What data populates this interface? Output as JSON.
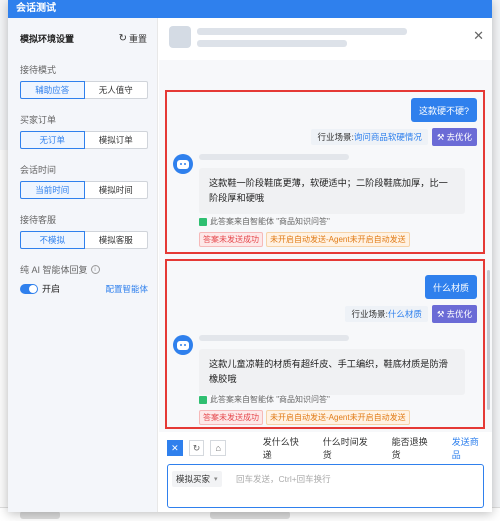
{
  "window": {
    "title": "会话测试"
  },
  "settings": {
    "title": "模拟环境设置",
    "reset_label": "重置",
    "reception_mode": {
      "label": "接待模式",
      "options": [
        "辅助应答",
        "无人值守"
      ],
      "active": 0
    },
    "buyer_order": {
      "label": "买家订单",
      "options": [
        "无订单",
        "模拟订单"
      ],
      "active": 0
    },
    "session_time": {
      "label": "会话时间",
      "options": [
        "当前时间",
        "模拟时间"
      ],
      "active": 0
    },
    "reception_cs": {
      "label": "接待客服",
      "options": [
        "不模拟",
        "模拟客服"
      ],
      "active": 0
    },
    "ai_agent": {
      "label": "纯 AI 智能体回复",
      "toggle_label": "开启",
      "enabled": true,
      "config_link": "配置智能体"
    }
  },
  "messages": [
    {
      "user_text": "这款硬不硬?",
      "scene_prefix": "行业场景:",
      "scene_value": "询问商品软硬情况",
      "optimize_label": "去优化",
      "bot_text": "这款鞋一阶段鞋底更薄，软硬适中；二阶段鞋底加厚，比一阶段厚和硬哦",
      "source_text": "此答案来自智能体 \"商品知识问答\"",
      "tag_sent": "答案未发送成功",
      "tag_auto": "未开启自动发送-Agent未开启自动发送"
    },
    {
      "user_text": "什么材质",
      "scene_prefix": "行业场景:",
      "scene_value": "什么材质",
      "optimize_label": "去优化",
      "bot_text": "这款儿童凉鞋的材质有超纤皮、手工编织，鞋底材质是防滑橡胶哦",
      "source_text": "此答案来自智能体 \"商品知识问答\"",
      "tag_sent": "答案未发送成功",
      "tag_auto": "未开启自动发送-Agent未开启自动发送"
    }
  ],
  "quick_replies": [
    "发什么快递",
    "什么时间发货",
    "能否退换货",
    "发送商品"
  ],
  "input": {
    "role": "模拟买家",
    "placeholder": "回车发送，Ctrl+回车换行"
  },
  "colors": {
    "primary": "#2f80ed",
    "highlight_border": "#e53935",
    "optimize": "#6b6bd6"
  }
}
